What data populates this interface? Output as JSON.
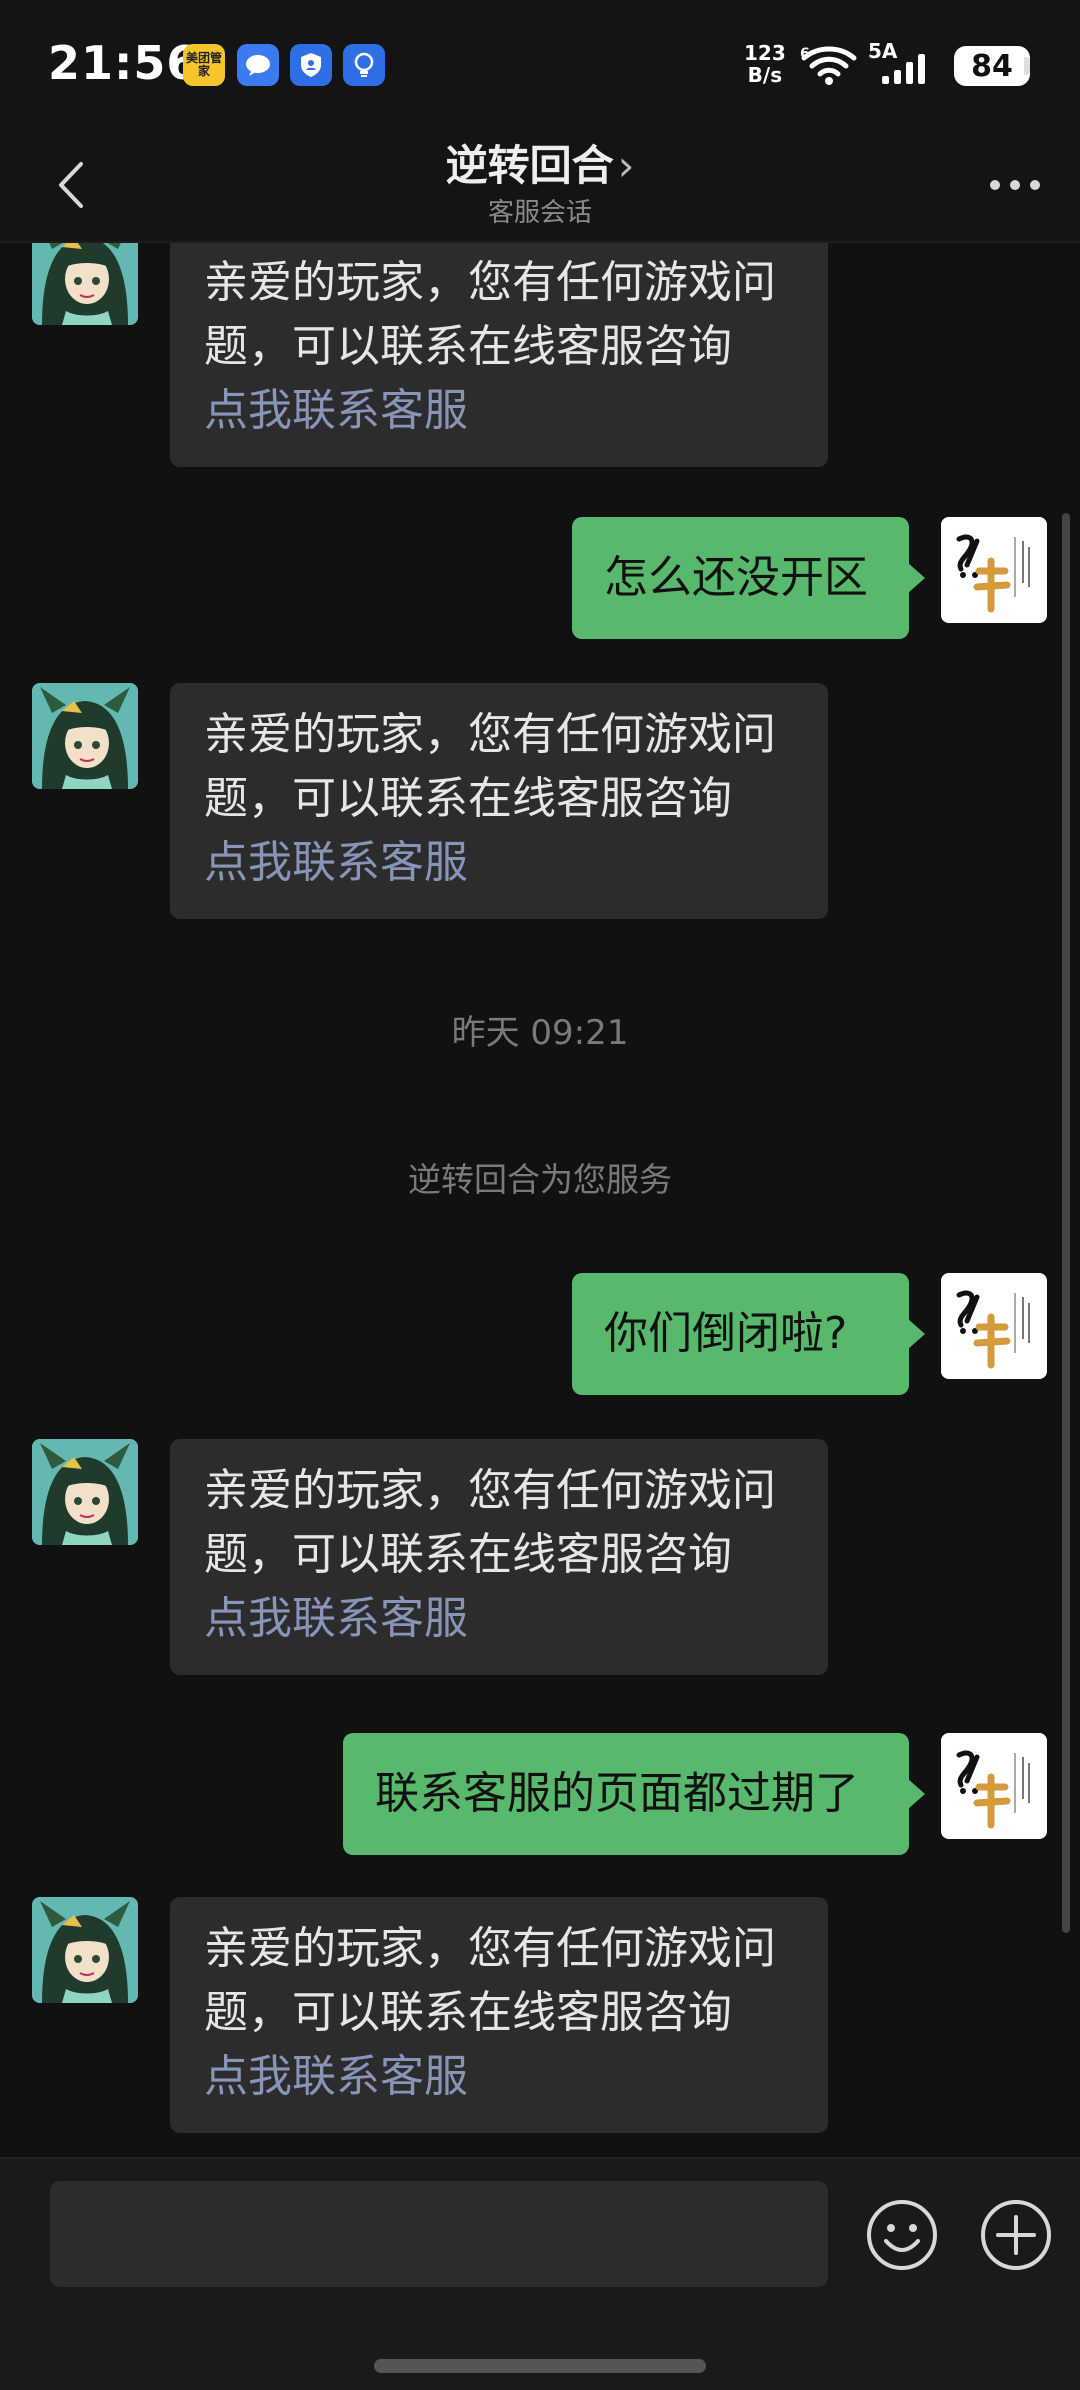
{
  "status_bar": {
    "time": "21:56",
    "meituan_label": "美团管家",
    "net_speed_value": "123",
    "net_speed_unit": "B/s",
    "network_type": "5A",
    "battery_level": "84"
  },
  "nav": {
    "title": "逆转回合",
    "subtitle": "客服会话"
  },
  "messages": [
    {
      "line1": "亲爱的玩家，您有任何游戏问",
      "line2": "题，可以联系在线客服咨询",
      "link": "点我联系客服"
    },
    {
      "text": "怎么还没开区"
    },
    {
      "line1": "亲爱的玩家，您有任何游戏问",
      "line2": "题，可以联系在线客服咨询",
      "link": "点我联系客服"
    },
    {
      "text": "你们倒闭啦?"
    },
    {
      "line1": "亲爱的玩家，您有任何游戏问",
      "line2": "题，可以联系在线客服咨询",
      "link": "点我联系客服"
    },
    {
      "text": "联系客服的页面都过期了"
    },
    {
      "line1": "亲爱的玩家，您有任何游戏问",
      "line2": "题，可以联系在线客服咨询",
      "link": "点我联系客服"
    }
  ],
  "timestamp": "昨天 09:21",
  "system_notice": "逆转回合为您服务",
  "input": {
    "value": ""
  },
  "colors": {
    "background": "#111111",
    "bubble_left": "#2c2c2c",
    "bubble_right": "#58b96c",
    "link": "#8796b8"
  },
  "icons": [
    "back-chevron-icon",
    "more-dots-icon",
    "emoji-icon",
    "plus-icon",
    "wifi-icon",
    "signal-icon"
  ]
}
